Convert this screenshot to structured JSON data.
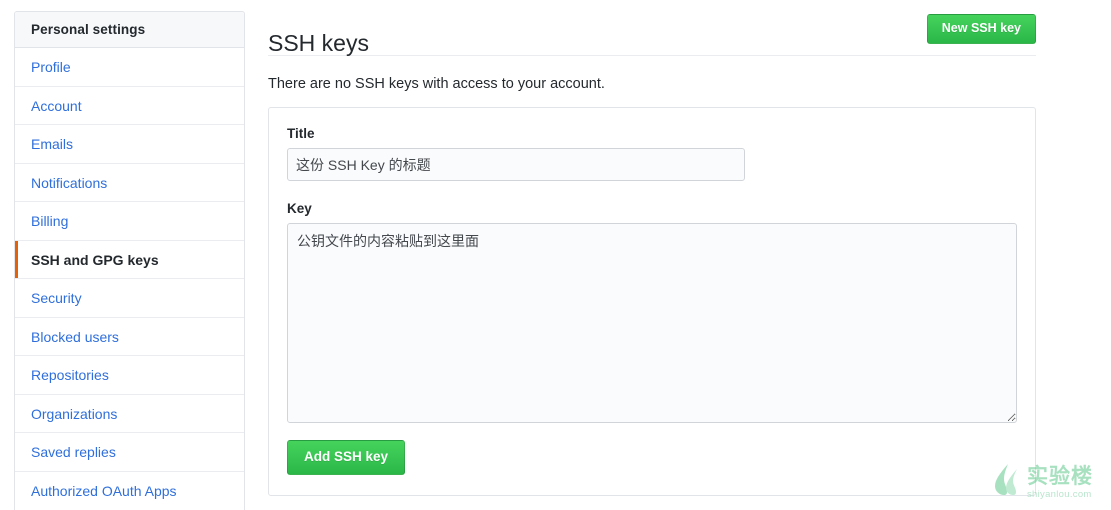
{
  "sidebar": {
    "header": "Personal settings",
    "items": [
      {
        "label": "Profile",
        "active": false
      },
      {
        "label": "Account",
        "active": false
      },
      {
        "label": "Emails",
        "active": false
      },
      {
        "label": "Notifications",
        "active": false
      },
      {
        "label": "Billing",
        "active": false
      },
      {
        "label": "SSH and GPG keys",
        "active": true
      },
      {
        "label": "Security",
        "active": false
      },
      {
        "label": "Blocked users",
        "active": false
      },
      {
        "label": "Repositories",
        "active": false
      },
      {
        "label": "Organizations",
        "active": false
      },
      {
        "label": "Saved replies",
        "active": false
      },
      {
        "label": "Authorized OAuth Apps",
        "active": false
      }
    ]
  },
  "main": {
    "title": "SSH keys",
    "new_key_button": "New SSH key",
    "empty_message": "There are no SSH keys with access to your account.",
    "form": {
      "title_label": "Title",
      "title_value": "",
      "title_placeholder": "这份 SSH Key 的标题",
      "key_label": "Key",
      "key_value": "",
      "key_placeholder": "公钥文件的内容粘贴到这里面",
      "submit_button": "Add SSH key"
    }
  },
  "watermark": {
    "name_cn": "实验楼",
    "name_en": "shiyanlou.com",
    "color": "#62c98d"
  },
  "colors": {
    "link": "#2f6fdb",
    "green_button": "#34c759",
    "active_indicator": "#e36209",
    "border": "#e1e4e8",
    "header_bg": "#f6f8fa"
  }
}
